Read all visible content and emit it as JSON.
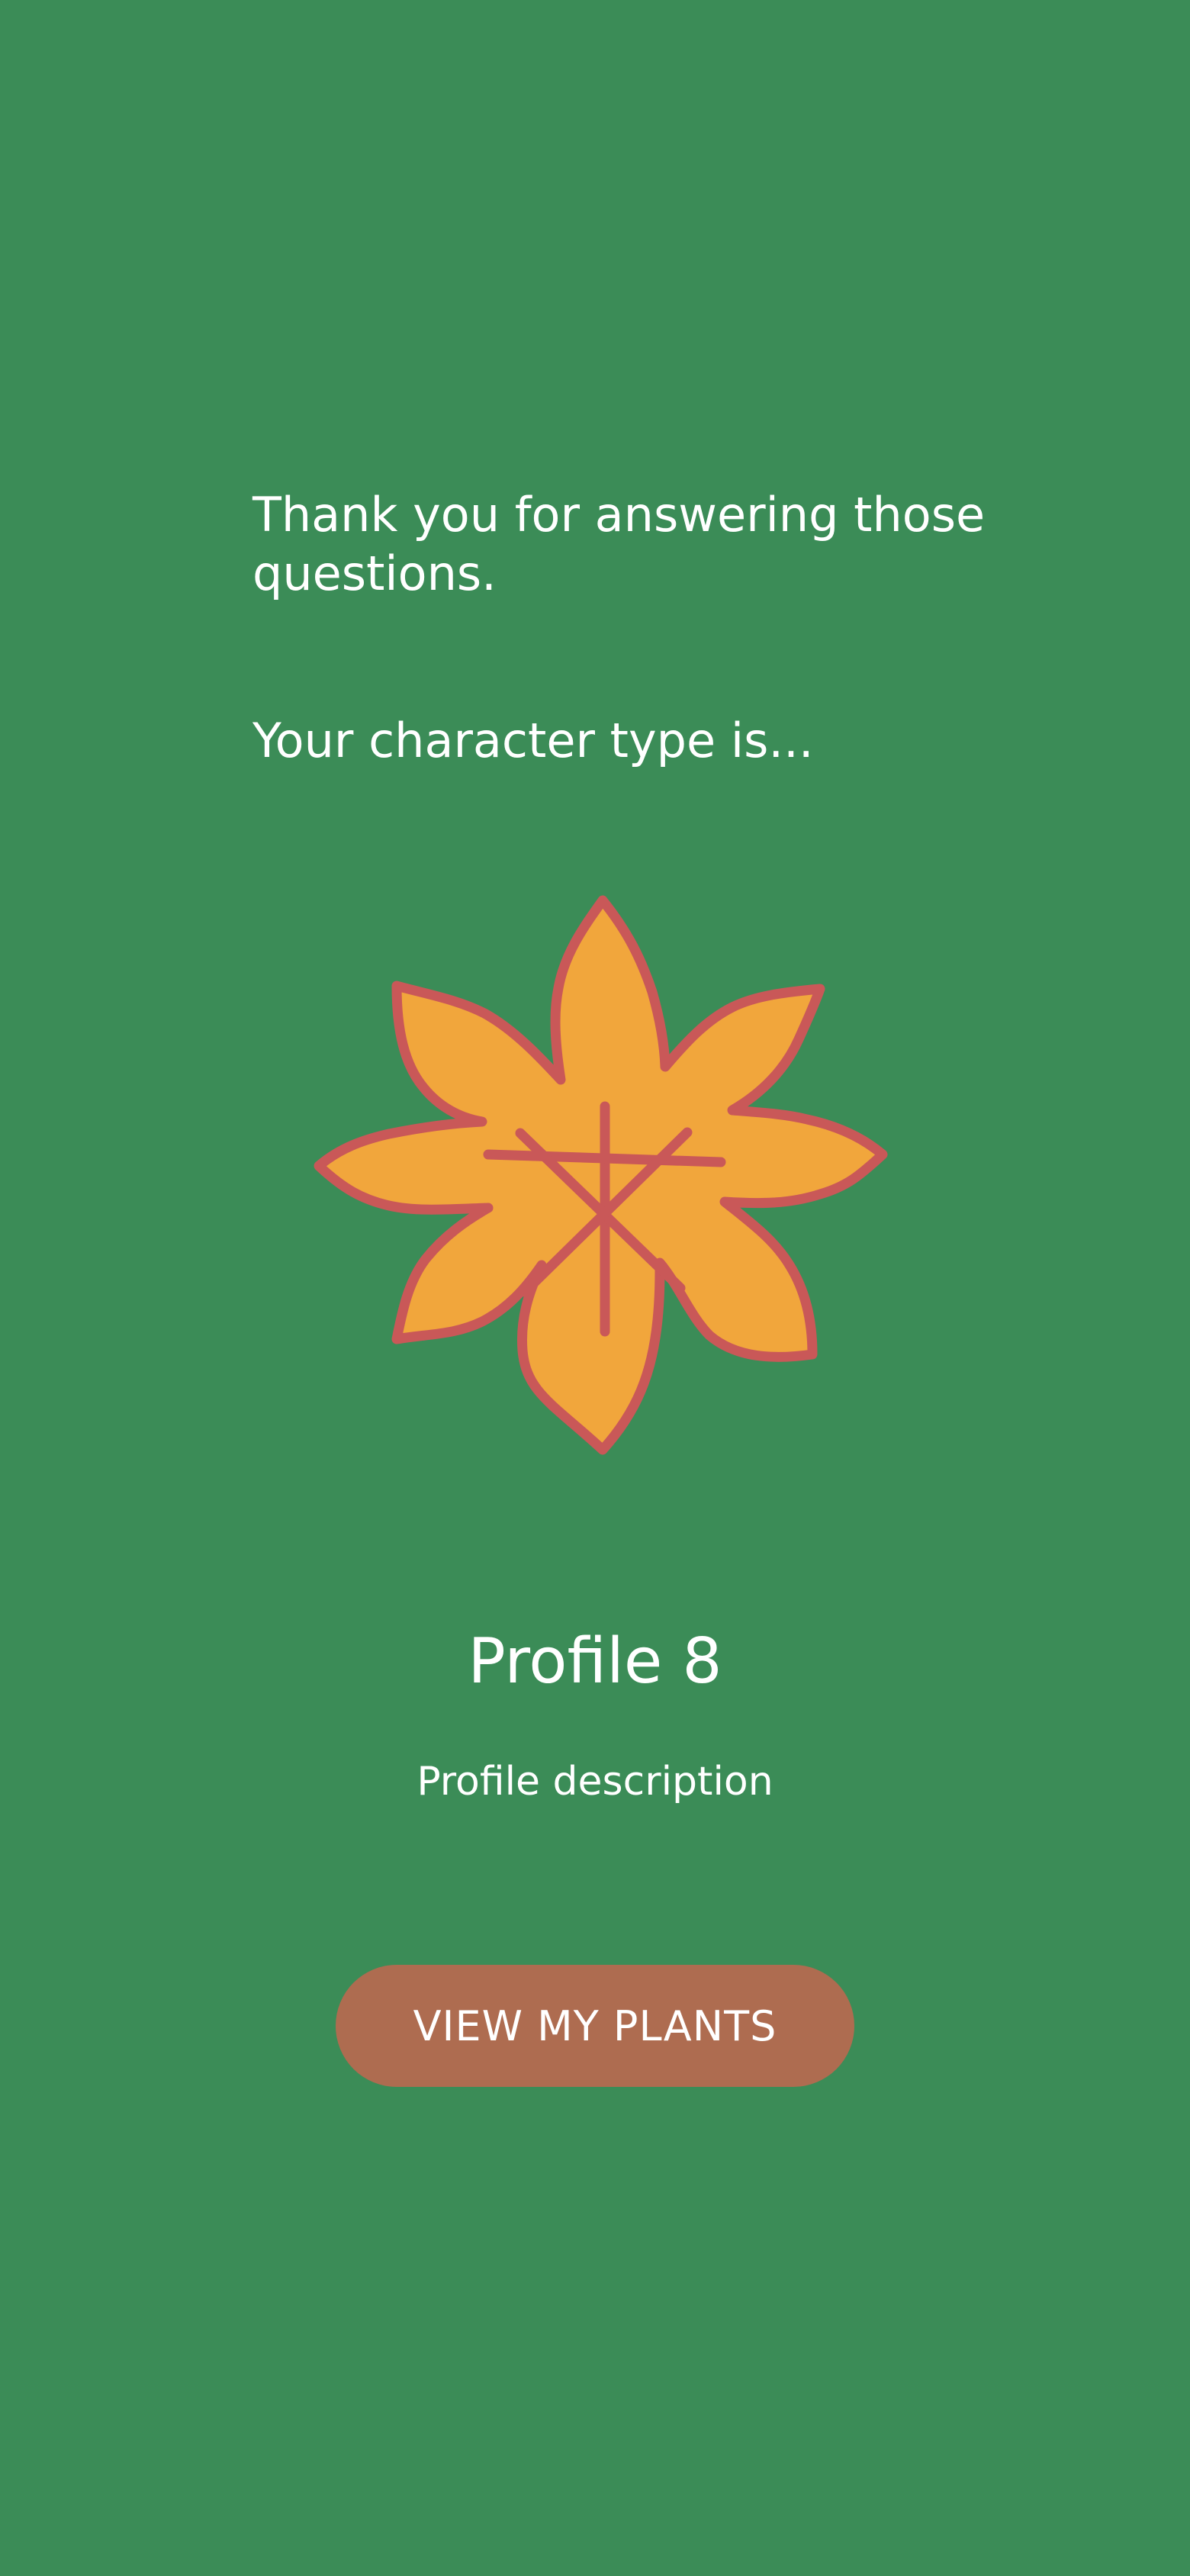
{
  "result": {
    "intro": "Thank you for answering those questions.",
    "character_intro": "Your character type is...",
    "profile_name": "Profile 8",
    "profile_description": "Profile description",
    "cta_label": "VIEW MY PLANTS"
  },
  "icons": {
    "profile_illustration": "flower-icon"
  },
  "colors": {
    "background": "#3b8c57",
    "text": "#ffffff",
    "button": "#ae6c50",
    "flower_fill": "#f1a63c",
    "flower_outline": "#c95858"
  }
}
